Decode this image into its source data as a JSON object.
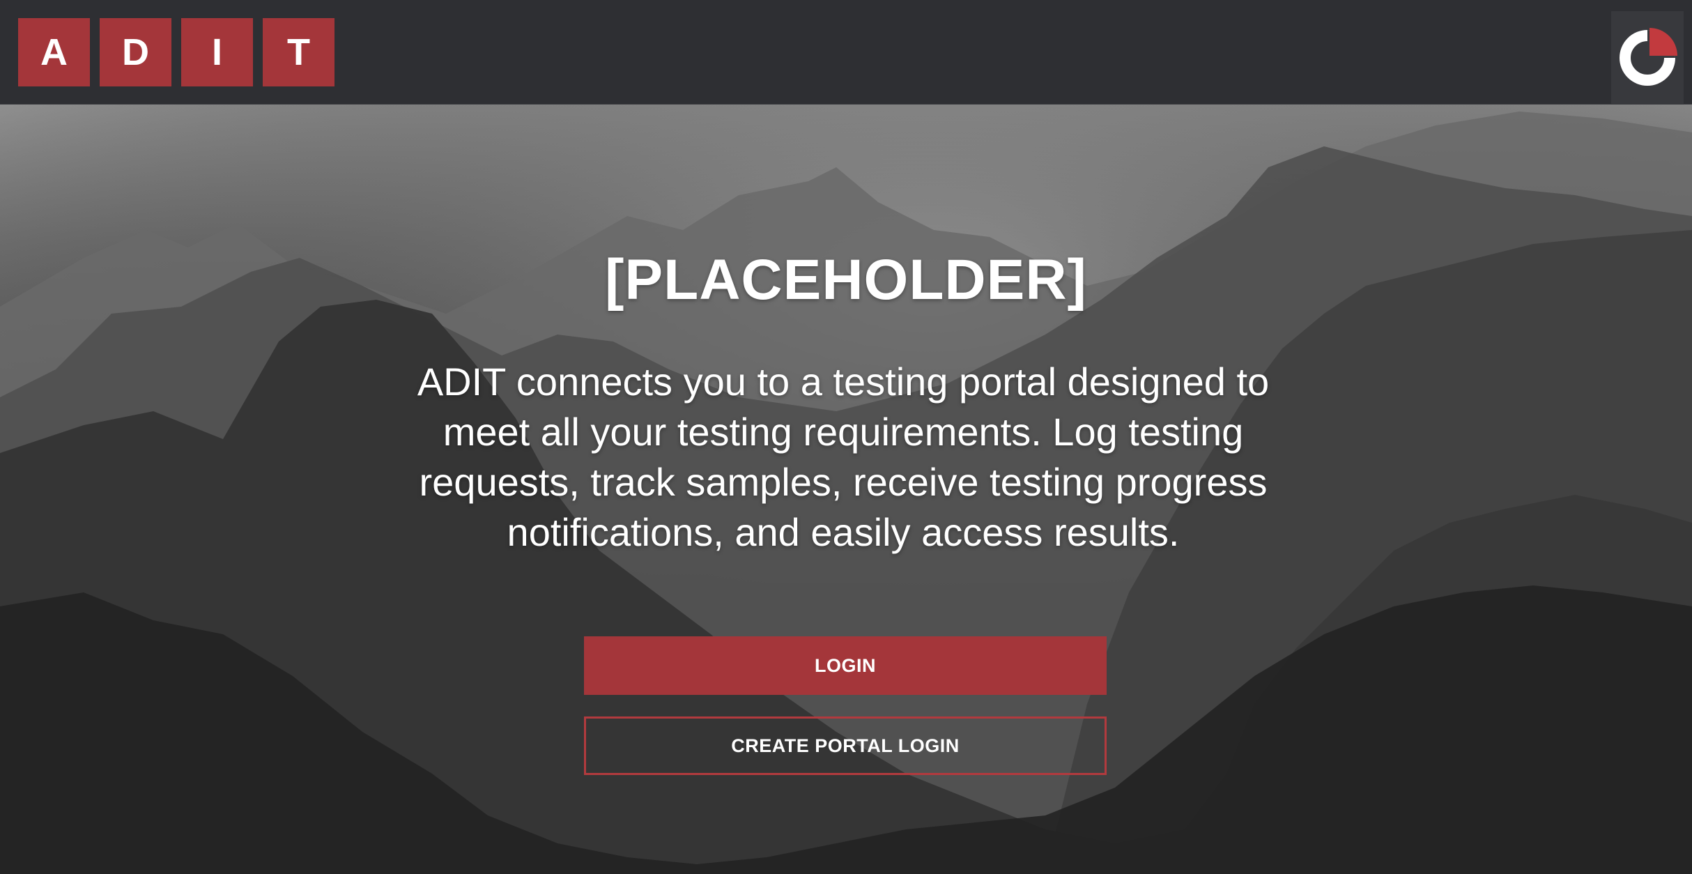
{
  "header": {
    "logo_letters": [
      "A",
      "D",
      "I",
      "T"
    ],
    "account_icon": "account-ring-icon",
    "brand_color": "#a4363a"
  },
  "hero": {
    "title": "[PLACEHOLDER]",
    "description": "ADIT connects you to a testing portal designed to meet all your testing requirements. Log testing requests, track samples, receive testing progress notifications, and easily access results.",
    "login_label": "LOGIN",
    "create_login_label": "CREATE PORTAL LOGIN",
    "background": "mountain-landscape-image"
  }
}
